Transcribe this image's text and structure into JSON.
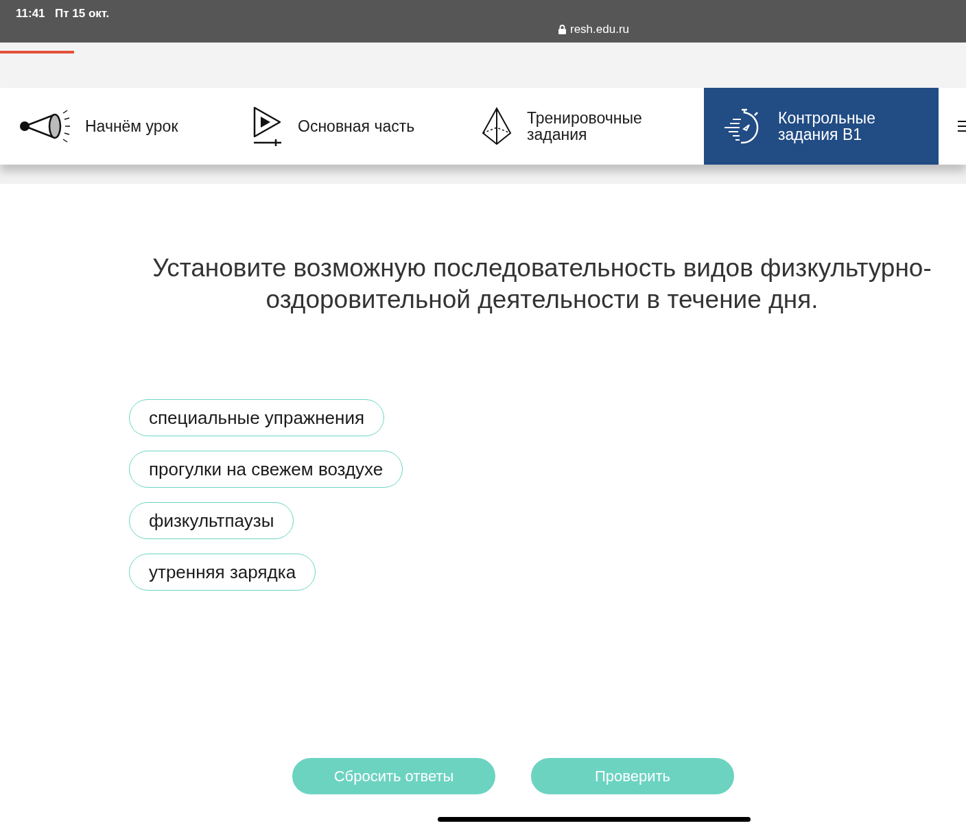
{
  "status_bar": {
    "time": "11:41",
    "date": "Пт 15 окт.",
    "url": "resh.edu.ru"
  },
  "tabs": [
    {
      "kind": "megaphone",
      "label": "Начнём урок",
      "selected": false
    },
    {
      "kind": "play",
      "label": "Основная часть",
      "selected": false
    },
    {
      "kind": "pyramid",
      "label": "Тренировочные задания",
      "selected": false
    },
    {
      "kind": "stopwatch",
      "label": "Контрольные задания В1",
      "selected": true
    }
  ],
  "question": "Установите возможную последовательность видов физкультурно-оздоровительной деятельности в течение дня.",
  "options": [
    "специальные упражнения",
    "прогулки на свежем воздухе",
    "физкультпаузы",
    "утренняя зарядка"
  ],
  "buttons": [
    {
      "label": "Сбросить ответы"
    },
    {
      "label": "Проверить"
    }
  ]
}
